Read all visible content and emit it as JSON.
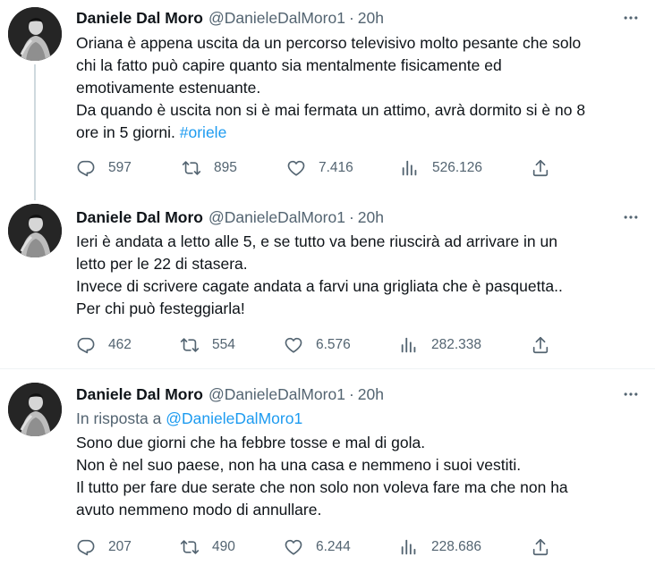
{
  "colors": {
    "text": "#0f1419",
    "secondary": "#536471",
    "link": "#1d9bf0",
    "thread_line": "#cfd9de"
  },
  "tweets": [
    {
      "name": "Daniele Dal Moro",
      "handle": "@DanieleDalMoro1",
      "separator": "·",
      "time": "20h",
      "body_lines": [
        "Oriana è appena uscita da un percorso televisivo molto pesante che solo",
        "chi la fatto può capire quanto sia mentalmente fisicamente ed",
        "emotivamente estenuante.",
        "Da quando è uscita non si è mai fermata un attimo, avrà dormito si è no 8",
        "ore in 5 giorni. "
      ],
      "hashtag": "#oriele",
      "stats": {
        "replies": "597",
        "retweets": "895",
        "likes": "7.416",
        "views": "526.126"
      }
    },
    {
      "name": "Daniele Dal Moro",
      "handle": "@DanieleDalMoro1",
      "separator": "·",
      "time": "20h",
      "body_lines": [
        "Ieri è andata a letto alle 5, e se tutto va bene  riuscirà ad arrivare in un",
        "letto per le 22 di stasera.",
        "Invece di scrivere cagate andata a farvi una grigliata che è pasquetta..",
        "Per chi può festeggiarla!"
      ],
      "stats": {
        "replies": "462",
        "retweets": "554",
        "likes": "6.576",
        "views": "282.338"
      }
    },
    {
      "name": "Daniele Dal Moro",
      "handle": "@DanieleDalMoro1",
      "separator": "·",
      "time": "20h",
      "reply_prefix": "In risposta a ",
      "reply_handle": "@DanieleDalMoro1",
      "body_lines": [
        "Sono due giorni che ha febbre tosse e mal di gola.",
        "Non è nel suo paese, non ha una casa e nemmeno i suoi vestiti.",
        "Il tutto per fare due serate che non solo non voleva fare ma che non ha",
        "avuto nemmeno modo di annullare."
      ],
      "stats": {
        "replies": "207",
        "retweets": "490",
        "likes": "6.244",
        "views": "228.686"
      }
    }
  ]
}
